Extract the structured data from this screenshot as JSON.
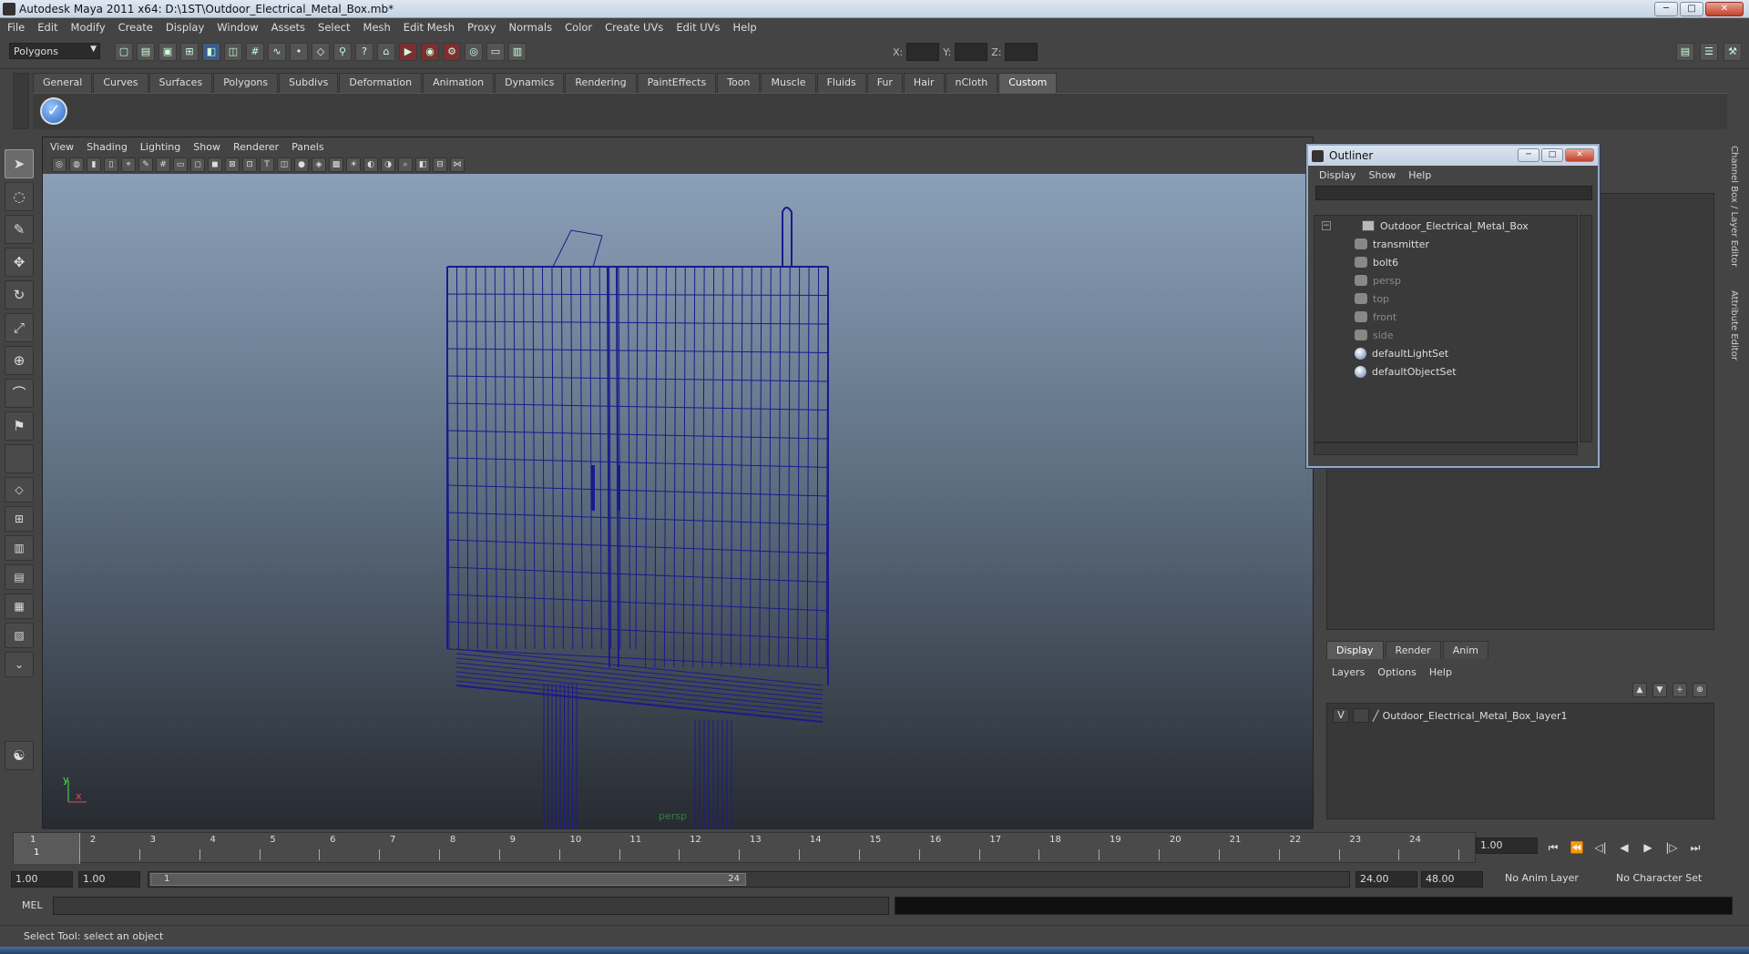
{
  "window": {
    "title": "Autodesk Maya 2011 x64: D:\\1ST\\Outdoor_Electrical_Metal_Box.mb*",
    "buttons": [
      "─",
      "□",
      "✕"
    ]
  },
  "menu": [
    "File",
    "Edit",
    "Modify",
    "Create",
    "Display",
    "Window",
    "Assets",
    "Select",
    "Mesh",
    "Edit Mesh",
    "Proxy",
    "Normals",
    "Color",
    "Create UVs",
    "Edit UVs",
    "Help"
  ],
  "status_line": {
    "mode": "Polygons",
    "coord_labels": [
      "X:",
      "Y:",
      "Z:"
    ]
  },
  "shelf": {
    "tabs": [
      "General",
      "Curves",
      "Surfaces",
      "Polygons",
      "Subdivs",
      "Deformation",
      "Animation",
      "Dynamics",
      "Rendering",
      "PaintEffects",
      "Toon",
      "Muscle",
      "Fluids",
      "Fur",
      "Hair",
      "nCloth",
      "Custom"
    ],
    "active_tab": "Custom"
  },
  "viewport": {
    "menu": [
      "View",
      "Shading",
      "Lighting",
      "Show",
      "Renderer",
      "Panels"
    ],
    "camera": "persp",
    "axis_y": "y",
    "axis_x": "x",
    "wire_color": "#1a1a8c"
  },
  "outliner": {
    "title": "Outliner",
    "menu": [
      "Display",
      "Show",
      "Help"
    ],
    "items": [
      {
        "label": "Outdoor_Electrical_Metal_Box",
        "icon": "mesh-icon",
        "dim": false
      },
      {
        "label": "transmitter",
        "icon": "transform-icon",
        "dim": false
      },
      {
        "label": "bolt6",
        "icon": "transform-icon",
        "dim": false
      },
      {
        "label": "persp",
        "icon": "camera-icon",
        "dim": true
      },
      {
        "label": "top",
        "icon": "camera-icon",
        "dim": true
      },
      {
        "label": "front",
        "icon": "camera-icon",
        "dim": true
      },
      {
        "label": "side",
        "icon": "camera-icon",
        "dim": true
      },
      {
        "label": "defaultLightSet",
        "icon": "set-icon",
        "dim": false
      },
      {
        "label": "defaultObjectSet",
        "icon": "set-icon",
        "dim": false
      }
    ]
  },
  "side_tabs": [
    "Channel Box / Layer Editor",
    "Attribute Editor"
  ],
  "layer_editor": {
    "tabs": [
      "Display",
      "Render",
      "Anim"
    ],
    "active_tab": "Display",
    "menu": [
      "Layers",
      "Options",
      "Help"
    ],
    "layers": [
      {
        "visible": "V",
        "name": "Outdoor_Electrical_Metal_Box_layer1"
      }
    ]
  },
  "time_slider": {
    "ticks": [
      "1",
      "2",
      "3",
      "4",
      "5",
      "6",
      "7",
      "8",
      "9",
      "10",
      "11",
      "12",
      "13",
      "14",
      "15",
      "16",
      "17",
      "18",
      "19",
      "20",
      "21",
      "22",
      "23",
      "24"
    ],
    "current_frame": "1",
    "current_time_field": "1.00"
  },
  "range_slider": {
    "start_time": "1.00",
    "playback_start": "1.00",
    "handle_start": "1",
    "handle_end": "24",
    "playback_end": "24.00",
    "end_time": "48.00",
    "anim_layer": "No Anim Layer",
    "character_set": "No Character Set"
  },
  "command_line": {
    "label": "MEL"
  },
  "help_line": "Select Tool: select an object"
}
